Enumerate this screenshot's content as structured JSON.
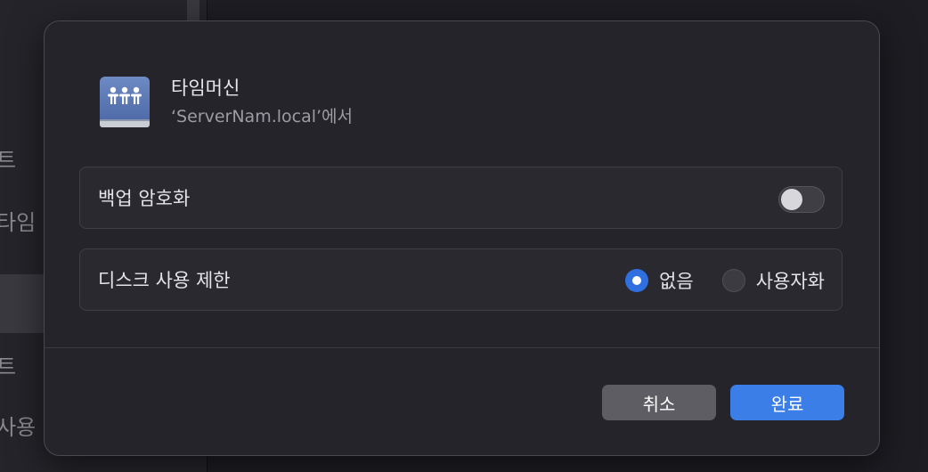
{
  "background": {
    "sidebar_fragments": [
      "트",
      "타임",
      "트",
      "사용"
    ]
  },
  "dialog": {
    "icon": "shared-drive-icon",
    "title": "타임머신",
    "subtitle": "‘ServerNam.local’에서",
    "encrypt_row": {
      "label": "백업 암호화",
      "toggle_on": false
    },
    "disk_limit_row": {
      "label": "디스크 사용 제한",
      "options": [
        "없음",
        "사용자화"
      ],
      "selected": "없음"
    },
    "buttons": {
      "cancel": "취소",
      "done": "완료"
    }
  },
  "colors": {
    "accent": "#3b7ee8",
    "radio_selected": "#2f6fe0"
  }
}
